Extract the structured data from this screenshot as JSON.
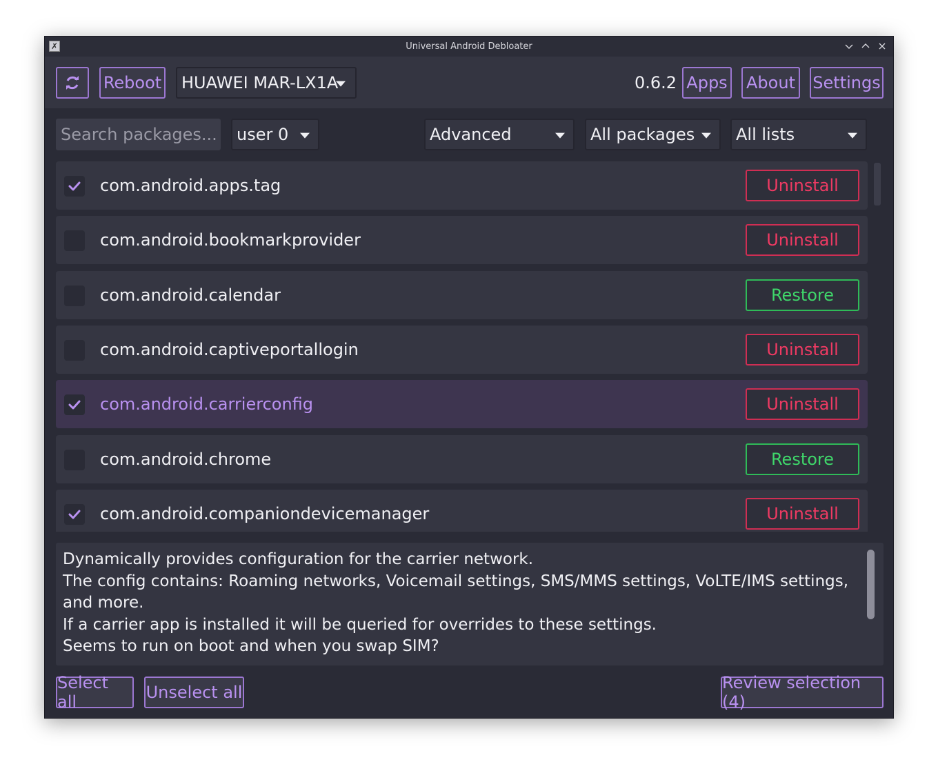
{
  "window": {
    "title": "Universal Android Debloater",
    "icon": "x-icon"
  },
  "header": {
    "refresh_icon": "refresh-icon",
    "reboot_label": "Reboot",
    "device": "HUAWEI MAR-LX1A",
    "version": "0.6.2",
    "apps_label": "Apps",
    "about_label": "About",
    "settings_label": "Settings"
  },
  "filters": {
    "search_placeholder": "Search packages...",
    "user": "user 0",
    "removal": "Advanced",
    "state": "All packages",
    "list": "All lists"
  },
  "packages": [
    {
      "name": "com.android.apps.tag",
      "checked": true,
      "selected": false,
      "action": "Uninstall"
    },
    {
      "name": "com.android.bookmarkprovider",
      "checked": false,
      "selected": false,
      "action": "Uninstall"
    },
    {
      "name": "com.android.calendar",
      "checked": false,
      "selected": false,
      "action": "Restore"
    },
    {
      "name": "com.android.captiveportallogin",
      "checked": false,
      "selected": false,
      "action": "Uninstall"
    },
    {
      "name": "com.android.carrierconfig",
      "checked": true,
      "selected": true,
      "action": "Uninstall"
    },
    {
      "name": "com.android.chrome",
      "checked": false,
      "selected": false,
      "action": "Restore"
    },
    {
      "name": "com.android.companiondevicemanager",
      "checked": true,
      "selected": false,
      "action": "Uninstall"
    }
  ],
  "description": {
    "lines": [
      "Dynamically provides configuration for the carrier network.",
      "The config contains: Roaming networks, Voicemail settings, SMS/MMS settings, VoLTE/IMS settings, and more.",
      "If a carrier app is installed it will be queried for overrides to these settings.",
      "Seems to run on boot and when you swap SIM?"
    ]
  },
  "footer": {
    "select_all": "Select all",
    "unselect_all": "Unselect all",
    "review": "Review selection (4)"
  },
  "colors": {
    "accent": "#b991f0",
    "uninstall": "#ef3a63",
    "restore": "#3fd66a",
    "background": "#2a2b36"
  }
}
